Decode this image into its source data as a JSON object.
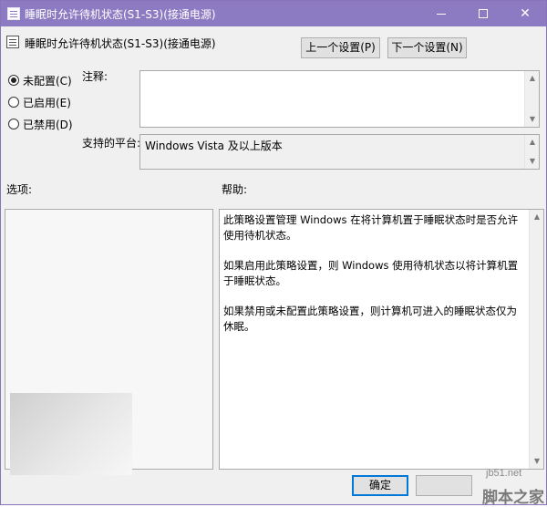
{
  "window": {
    "title": "睡眠时允许待机状态(S1-S3)(接通电源)",
    "controls": {
      "minimize": "minimize",
      "maximize": "maximize",
      "close": "✕"
    }
  },
  "header": {
    "title": "睡眠时允许待机状态(S1-S3)(接通电源)",
    "prev_button": "上一个设置(P)",
    "next_button": "下一个设置(N)"
  },
  "state_options": [
    {
      "label": "未配置(C)",
      "checked": true
    },
    {
      "label": "已启用(E)",
      "checked": false
    },
    {
      "label": "已禁用(D)",
      "checked": false
    }
  ],
  "comment": {
    "label": "注释:",
    "value": ""
  },
  "platform": {
    "label": "支持的平台:",
    "value": "Windows Vista 及以上版本"
  },
  "options": {
    "label": "选项:"
  },
  "help": {
    "label": "帮助:",
    "paragraphs": [
      "此策略设置管理 Windows 在将计算机置于睡眠状态时是否允许使用待机状态。",
      "如果启用此策略设置，则 Windows 使用待机状态以将计算机置于睡眠状态。",
      "如果禁用或未配置此策略设置，则计算机可进入的睡眠状态仅为休眠。"
    ]
  },
  "footer": {
    "ok_button": "确定"
  },
  "watermark": {
    "site": "jb51.net",
    "brand": "脚本之家"
  },
  "colors": {
    "titlebar": "#8c7bc2",
    "window_bg": "#f0f0f0",
    "focus_border": "#0078d7"
  }
}
